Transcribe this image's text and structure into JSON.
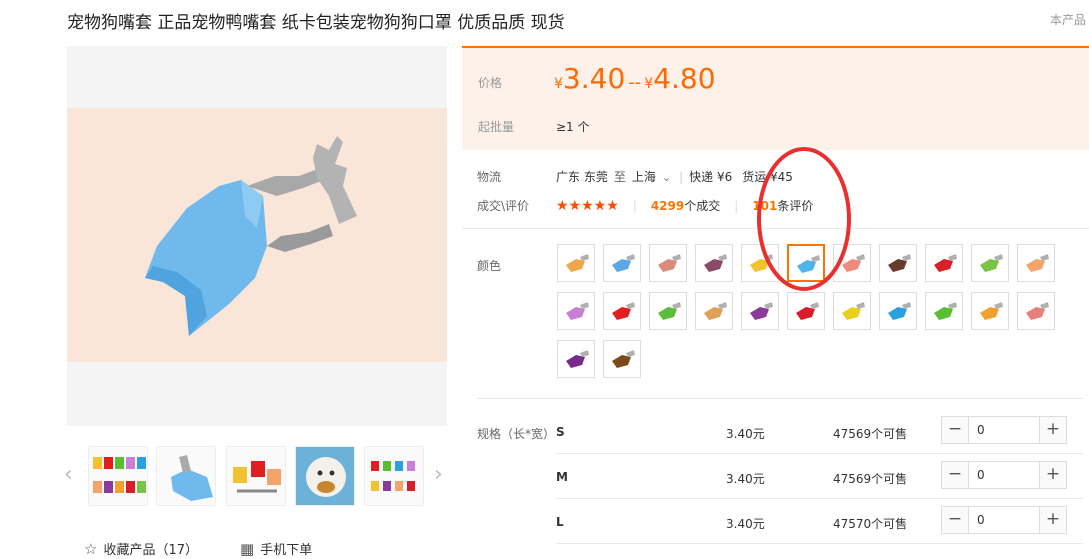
{
  "product": {
    "title": "宠物狗嘴套 正品宠物鸭嘴套 纸卡包装宠物狗狗口罩 优质品质 现货",
    "top_right_text": "本产品"
  },
  "gallery": {
    "prev_arrow": "‹",
    "next_arrow": "›",
    "thumbnails": [
      "colorful-muzzles-set",
      "blue-muzzle",
      "muzzles-on-white",
      "dog-wearing-muzzle",
      "muzzles-row"
    ]
  },
  "actions": {
    "favorite_icon": "☆",
    "favorite_label": "收藏产品（17）",
    "mobile_icon": "▦",
    "mobile_label": "手机下单"
  },
  "price": {
    "label": "价格",
    "currency": "¥",
    "min": "3.40",
    "separator": "--",
    "max": "4.80"
  },
  "moq": {
    "label": "起批量",
    "value": "≥1 个"
  },
  "logistics": {
    "label": "物流",
    "from": "广东 东莞",
    "to_word": "至",
    "to": "上海",
    "express": "快递 ¥6",
    "freight": "货运 ¥45"
  },
  "reviews": {
    "label": "成交\\评价",
    "stars": "★★★★★",
    "deal_count": "4299",
    "deal_suffix": "个成交",
    "review_count": "101",
    "review_suffix": "条评价"
  },
  "color": {
    "label": "颜色",
    "options": [
      {
        "name": "orange",
        "hex": "#f2a64a"
      },
      {
        "name": "blue-light",
        "hex": "#5aa9e6"
      },
      {
        "name": "pink-dark",
        "hex": "#d98c7a"
      },
      {
        "name": "brown-purple",
        "hex": "#8a4a6a"
      },
      {
        "name": "yellow",
        "hex": "#f2c230"
      },
      {
        "name": "sky-blue",
        "hex": "#4fb4ea"
      },
      {
        "name": "salmon",
        "hex": "#f08a7a"
      },
      {
        "name": "brown",
        "hex": "#6a3a2a"
      },
      {
        "name": "red",
        "hex": "#d8202a"
      },
      {
        "name": "green-light",
        "hex": "#7cc244"
      },
      {
        "name": "peach",
        "hex": "#f4a46a"
      },
      {
        "name": "lavender",
        "hex": "#c77fd8"
      },
      {
        "name": "red-2",
        "hex": "#e02020"
      },
      {
        "name": "green",
        "hex": "#5cbc3c"
      },
      {
        "name": "tan",
        "hex": "#e0a058"
      },
      {
        "name": "purple",
        "hex": "#8a3a9a"
      },
      {
        "name": "red-3",
        "hex": "#d81c2c"
      },
      {
        "name": "yellow-2",
        "hex": "#e8d020"
      },
      {
        "name": "blue",
        "hex": "#2aa0e0"
      },
      {
        "name": "green-2",
        "hex": "#58c030"
      },
      {
        "name": "orange-2",
        "hex": "#f2a030"
      },
      {
        "name": "rose",
        "hex": "#e8807a"
      },
      {
        "name": "purple-2",
        "hex": "#7a2a8a"
      },
      {
        "name": "brown-2",
        "hex": "#7a4a1a"
      }
    ],
    "selected_index": 5
  },
  "spec": {
    "label": "规格（长*宽）",
    "rows": [
      {
        "name": "S",
        "price": "3.40元",
        "stock": "47569个可售",
        "qty": "0"
      },
      {
        "name": "M",
        "price": "3.40元",
        "stock": "47569个可售",
        "qty": "0"
      },
      {
        "name": "L",
        "price": "3.40元",
        "stock": "47570个可售",
        "qty": "0"
      }
    ],
    "minus_label": "−",
    "plus_label": "+"
  },
  "annotation": {
    "color": "#e83030"
  }
}
